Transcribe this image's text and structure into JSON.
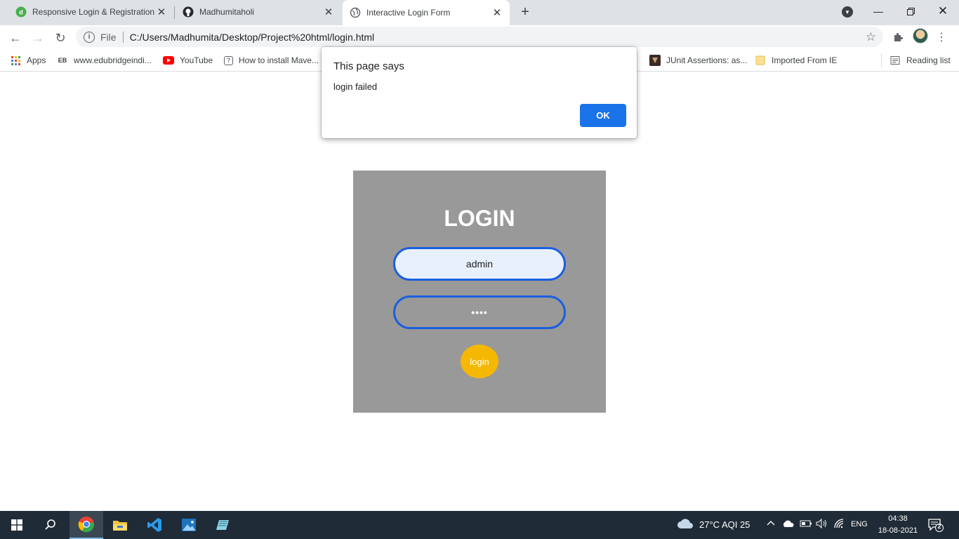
{
  "browser": {
    "tabs": [
      {
        "title": "Responsive Login & Registration",
        "active": false
      },
      {
        "title": "Madhumitaholi",
        "active": false
      },
      {
        "title": "Interactive Login Form",
        "active": true
      }
    ],
    "omnibox": {
      "scheme": "File",
      "url": "C:/Users/Madhumita/Desktop/Project%20html/login.html"
    },
    "bookmarks": [
      {
        "label": "Apps",
        "icon": "apps-grid-icon"
      },
      {
        "label": "www.edubridgeindi...",
        "icon": "eb-icon"
      },
      {
        "label": "YouTube",
        "icon": "youtube-icon"
      },
      {
        "label": "How to install Mave...",
        "icon": "question-icon"
      },
      {
        "label": "JUnit Assertions: as...",
        "icon": "site-icon"
      },
      {
        "label": "Imported From IE",
        "icon": "folder-icon"
      }
    ],
    "reading_list": "Reading list"
  },
  "dialog": {
    "title": "This page says",
    "message": "login failed",
    "ok_label": "OK"
  },
  "login_form": {
    "heading": "LOGIN",
    "username_value": "admin",
    "password_value": "••••",
    "button_label": "login",
    "colors": {
      "card_bg": "#999999",
      "field_border": "#1a5fe0",
      "button_bg": "#f5b800"
    }
  },
  "taskbar": {
    "weather": "27°C  AQI 25",
    "language": "ENG",
    "time": "04:38",
    "date": "18-08-2021",
    "notification_count": "2"
  }
}
